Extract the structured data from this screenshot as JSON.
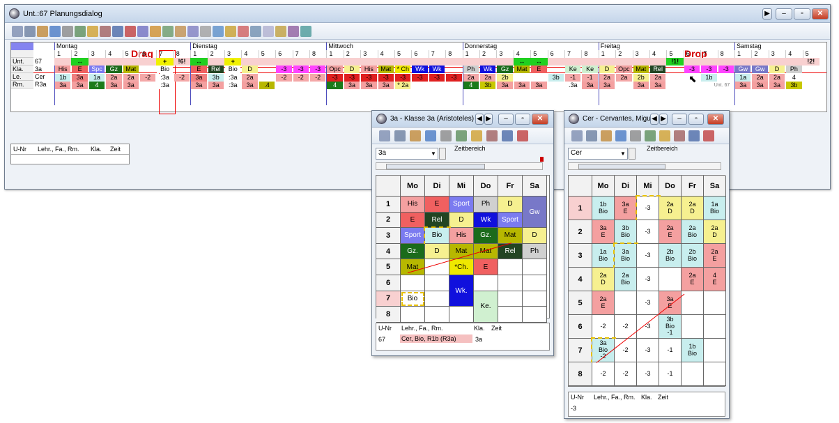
{
  "main_window": {
    "title": "Unt.:67  Planungsdialog"
  },
  "days": [
    "Montag",
    "Dienstag",
    "Mittwoch",
    "Donnerstag",
    "Freitag",
    "Samstag"
  ],
  "periods": [
    "1",
    "2",
    "3",
    "4",
    "5",
    "6",
    "7",
    "8"
  ],
  "sat_periods": [
    "1",
    "2",
    "3",
    "4",
    "5"
  ],
  "row_labels": {
    "unt": "Unt.",
    "kla": "Kla.",
    "le": "Le.",
    "rm": "Rm."
  },
  "row_values": {
    "unt": "67",
    "kla": "3a",
    "le": "Cer",
    "rm": "R3a"
  },
  "drag_label": "Drag",
  "drop_label": "Drop",
  "marks": {
    "mon_p8": "!6!",
    "fri_p5": "!1!",
    "sat_p5": "!2!",
    "arrows": "↔",
    "plus": "+"
  },
  "mon": {
    "kla": [
      "His",
      "E",
      "Spc",
      "Gz",
      "Mat",
      "",
      "Bio",
      ""
    ],
    "le": [
      "1b",
      "3a",
      "1a",
      "2a",
      "2a",
      "-2",
      ":3a",
      "-2"
    ],
    "rm": [
      "3a",
      "3a",
      "4",
      "3a",
      "3a",
      "",
      ":3a",
      ""
    ]
  },
  "die": {
    "kla": [
      "E",
      "Rel",
      "Bio",
      "D",
      "",
      "-3",
      "-3",
      "-3"
    ],
    "le": [
      "3a",
      "3b",
      ":3a",
      "2a",
      "",
      "-2",
      "-2",
      "-2"
    ],
    "rm": [
      "3a",
      "3a",
      ":3a",
      "3a",
      ".4",
      "",
      "",
      ""
    ]
  },
  "mit": {
    "kla": [
      "Opc",
      "D",
      "His",
      "Mat",
      "* Ch",
      "Wk",
      "Wk",
      ""
    ],
    "le": [
      "-3",
      "-3",
      "-3",
      "-3",
      "-3",
      "-3",
      "-3",
      "-3"
    ],
    "rm": [
      "4",
      "3a",
      "3a",
      "3a",
      "* 2a",
      "",
      "",
      ""
    ]
  },
  "don": {
    "kla": [
      "Ph",
      "Wk",
      "Gz",
      "Mat",
      "E",
      "",
      "Ke",
      "Ke"
    ],
    "le": [
      "2a",
      "2a",
      "2b",
      "",
      "",
      "3b",
      "-1",
      "-1"
    ],
    "rm": [
      "4",
      "3b",
      "3a",
      "3a",
      "3a",
      "",
      ".3a",
      "3a"
    ]
  },
  "fre": {
    "kla": [
      "D",
      "Opc",
      "Mat",
      "Rel",
      "",
      "-3",
      "-3",
      "-3"
    ],
    "le": [
      "2a",
      "2a",
      "2b",
      "2a",
      "",
      "",
      "1b",
      ""
    ],
    "rm": [
      "3a",
      "",
      "3a",
      "3a",
      "",
      "",
      "",
      ""
    ]
  },
  "sam": {
    "kla": [
      "Gw",
      "Gw",
      "D",
      "Ph",
      ""
    ],
    "le": [
      "1a",
      "2a",
      "2a",
      "4",
      ""
    ],
    "rm": [
      "3a",
      "3a",
      "3a",
      "3b",
      ""
    ]
  },
  "drop_ghost": "Unt. 67",
  "panel": {
    "headers": [
      "U-Nr",
      "Lehr., Fa., Rm.",
      "Kla.",
      "Zeit"
    ]
  },
  "w1": {
    "title": "3a - Klasse 3a (Aristoteles)",
    "select": "3a",
    "zeitbereich": "Zeitbereich",
    "days": [
      "Mo",
      "Di",
      "Mi",
      "Do",
      "Fr",
      "Sa"
    ],
    "periods": [
      "1",
      "2",
      "3",
      "4",
      "5",
      "6",
      "7",
      "8"
    ],
    "rows": [
      [
        "His",
        "E",
        "Sport",
        "Ph",
        "D",
        "Gw"
      ],
      [
        "E",
        "Rel",
        "D",
        "Wk",
        "Sport",
        ""
      ],
      [
        "Sport",
        "Bio",
        "His",
        "Gz.",
        "Mat",
        "D"
      ],
      [
        "Gz.",
        "D",
        "Mat",
        "Mat",
        "Rel",
        "Ph"
      ],
      [
        "Mat",
        "",
        "*Ch.",
        "E",
        "",
        ""
      ]
    ],
    "wk": "Wk.",
    "bio7": "Bio",
    "ke": "Ke.",
    "panel_row": {
      "unr": "67",
      "lehr": "Cer, Bio, R1b (R3a)",
      "kla": "3a"
    }
  },
  "w2": {
    "title": "Cer - Cervantes, Migu",
    "select": "Cer",
    "zeitbereich": "Zeitbereich",
    "days": [
      "Mo",
      "Di",
      "Mi",
      "Do",
      "Fr",
      "Sa"
    ],
    "periods": [
      "1",
      "2",
      "3",
      "4",
      "5",
      "6",
      "7",
      "8"
    ],
    "cells": [
      [
        [
          "1b",
          "Bio"
        ],
        [
          "3a",
          "E"
        ],
        [
          "-3",
          ""
        ],
        [
          "2a",
          "D"
        ],
        [
          "2a",
          "D"
        ],
        [
          "1a",
          "Bio"
        ]
      ],
      [
        [
          "3a",
          "E"
        ],
        [
          "3b",
          "Bio"
        ],
        [
          "-3",
          ""
        ],
        [
          "2a",
          "E"
        ],
        [
          "2a",
          "Bio"
        ],
        [
          "2a",
          "D"
        ]
      ],
      [
        [
          "1a",
          "Bio"
        ],
        [
          "3a",
          "Bio"
        ],
        [
          "-3",
          ""
        ],
        [
          "2b",
          "Bio"
        ],
        [
          "2b",
          "Bio"
        ],
        [
          "2a",
          "E"
        ]
      ],
      [
        [
          "2a",
          "D"
        ],
        [
          "2a",
          "Bio"
        ],
        [
          "-3",
          ""
        ],
        [
          "",
          ""
        ],
        [
          "2a",
          "E"
        ],
        [
          "4",
          "E"
        ]
      ],
      [
        [
          "2a",
          "E"
        ],
        [
          "",
          ""
        ],
        [
          "-3",
          ""
        ],
        [
          "3a",
          "E"
        ],
        [
          "",
          ""
        ],
        [
          "",
          ""
        ]
      ],
      [
        [
          "-2",
          ""
        ],
        [
          "-2",
          ""
        ],
        [
          "-3",
          ""
        ],
        [
          "3b",
          "Bio"
        ],
        [
          "",
          ""
        ],
        [
          "",
          ""
        ]
      ],
      [
        [
          "3a",
          "Bio"
        ],
        [
          "-2",
          ""
        ],
        [
          "-3",
          ""
        ],
        [
          "-1",
          ""
        ],
        [
          "1b",
          "Bio"
        ],
        [
          "",
          ""
        ]
      ],
      [
        [
          "-2",
          ""
        ],
        [
          "-2",
          ""
        ],
        [
          "-3",
          ""
        ],
        [
          "-1",
          ""
        ],
        [
          "",
          ""
        ],
        [
          "",
          ""
        ]
      ]
    ],
    "do6_sub": "-1",
    "mo7_sub": "-2",
    "panel_row": {
      "unr": "-3"
    }
  },
  "colors": {
    "accent": "#7676e0",
    "title": "#d5e3f3"
  }
}
